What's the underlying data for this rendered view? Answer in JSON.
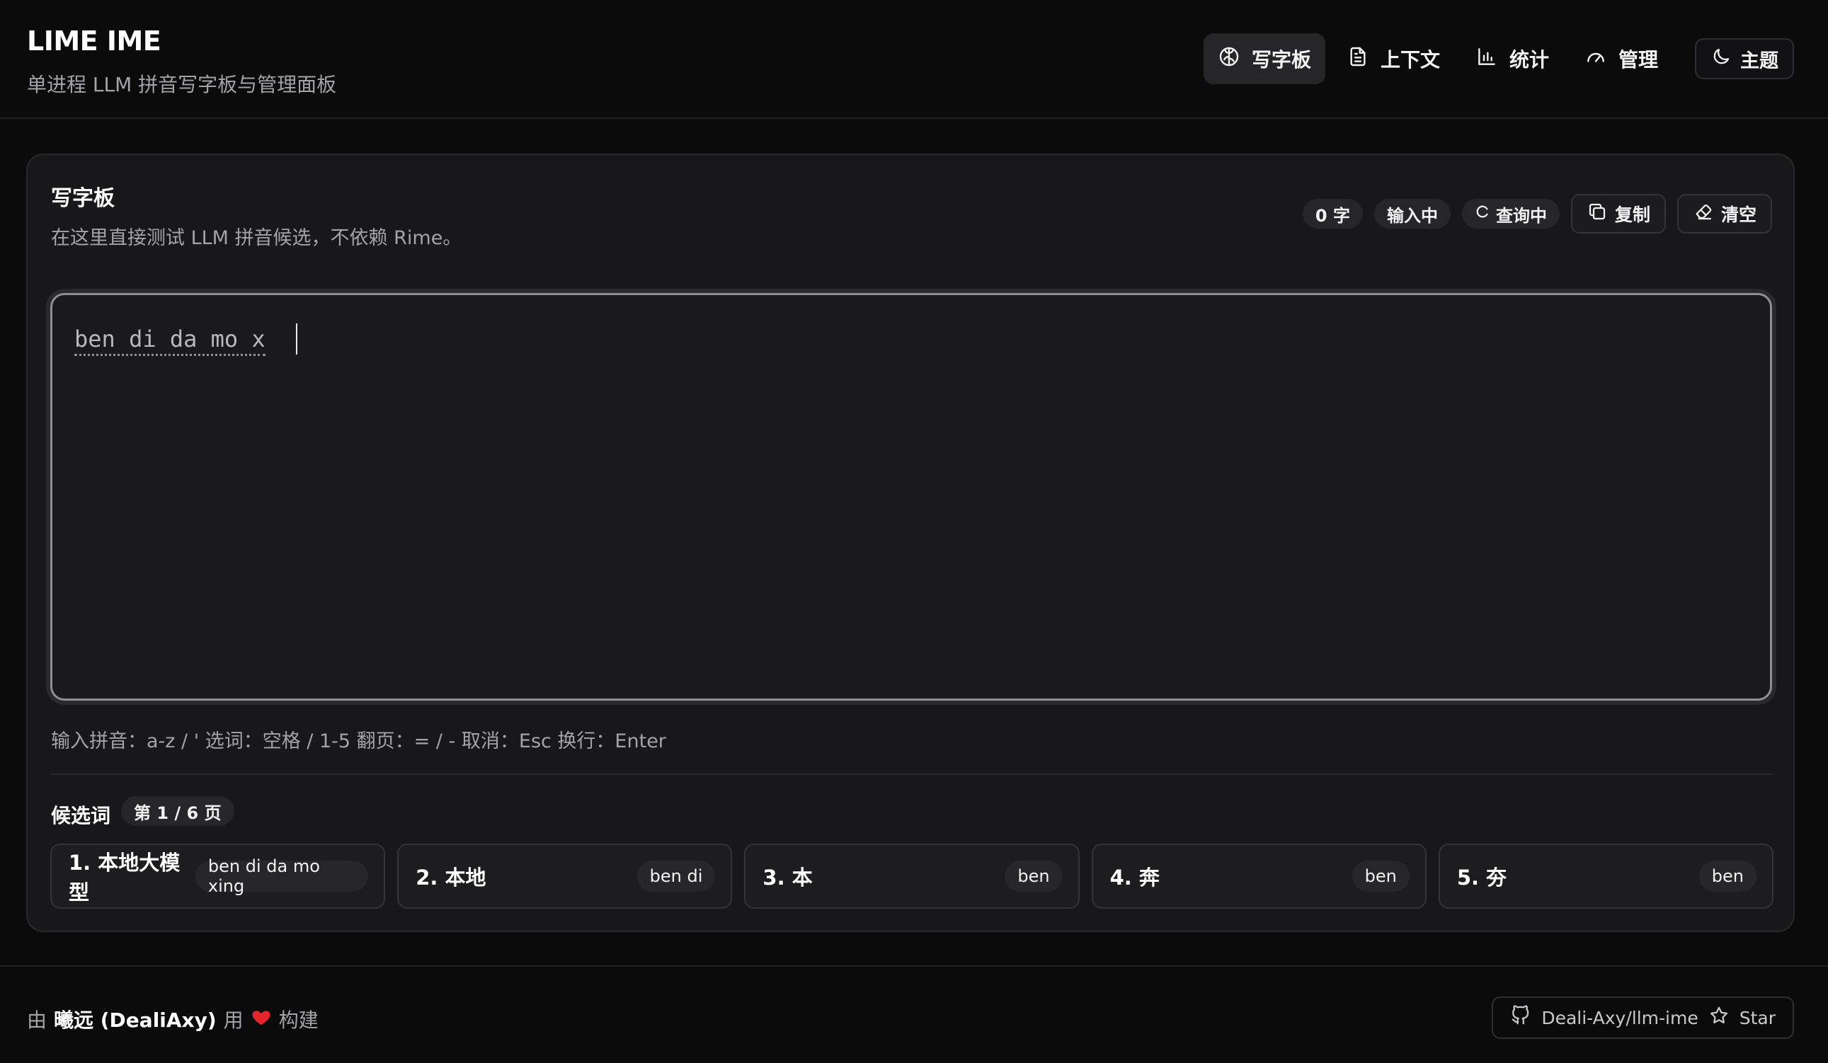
{
  "app": {
    "title": "LIME IME",
    "subtitle": "单进程 LLM 拼音写字板与管理面板"
  },
  "nav": {
    "items": [
      {
        "label": "写字板",
        "icon": "brain-icon",
        "active": true
      },
      {
        "label": "上下文",
        "icon": "document-icon",
        "active": false
      },
      {
        "label": "统计",
        "icon": "bar-chart-icon",
        "active": false
      },
      {
        "label": "管理",
        "icon": "gauge-icon",
        "active": false
      }
    ],
    "theme_label": "主题"
  },
  "card": {
    "title": "写字板",
    "subtitle": "在这里直接测试 LLM 拼音候选，不依赖 Rime。",
    "char_count": "0 字",
    "status": "输入中",
    "query_status": "查询中",
    "copy_label": "复制",
    "clear_label": "清空"
  },
  "editor": {
    "composing_text": "ben di da mo x"
  },
  "hint": "输入拼音：a-z / '  选词：空格 / 1-5  翻页：= / -  取消：Esc  换行：Enter",
  "candidates": {
    "label": "候选词",
    "page_info": "第 1 / 6 页",
    "items": [
      {
        "word": "1. 本地大模型",
        "pinyin": "ben di da mo xing"
      },
      {
        "word": "2. 本地",
        "pinyin": "ben di"
      },
      {
        "word": "3. 本",
        "pinyin": "ben"
      },
      {
        "word": "4. 奔",
        "pinyin": "ben"
      },
      {
        "word": "5. 夯",
        "pinyin": "ben"
      }
    ]
  },
  "footer": {
    "prefix": "由",
    "author": "曦远 (DealiAxy)",
    "middle": "用",
    "suffix": "构建",
    "repo": "Deali-Axy/llm-ime",
    "star_label": "Star"
  },
  "colors": {
    "background": "#0b0b0c",
    "card": "#18181a",
    "heart": "#e5242b"
  }
}
